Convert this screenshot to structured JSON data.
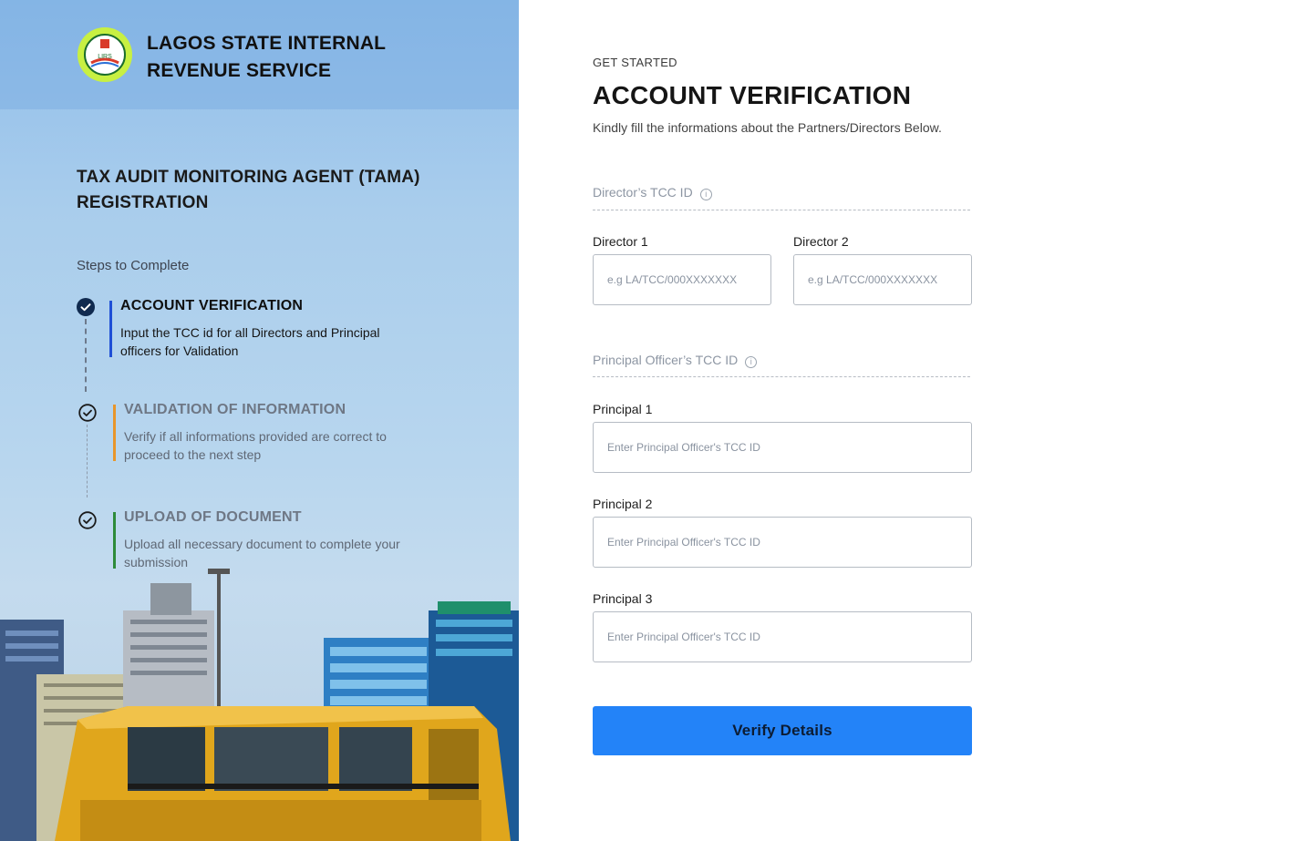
{
  "brand": {
    "org_name": "LAGOS STATE INTERNAL REVENUE SERVICE",
    "logo_text": "LIRS"
  },
  "sidebar": {
    "heading": "TAX AUDIT MONITORING AGENT (TAMA) REGISTRATION",
    "steps_label": "Steps to Complete",
    "steps": [
      {
        "title": "ACCOUNT VERIFICATION",
        "desc": "Input the TCC id for all Directors and Principal officers for Validation",
        "status": "active",
        "accent": "#1f4fd6"
      },
      {
        "title": "VALIDATION OF INFORMATION",
        "desc": "Verify if all informations provided are correct to proceed to the next step",
        "status": "pending",
        "accent": "#e8962b"
      },
      {
        "title": "UPLOAD OF DOCUMENT",
        "desc": "Upload all necessary document to complete your submission",
        "status": "pending",
        "accent": "#2e8b3a"
      }
    ]
  },
  "form": {
    "eyebrow": "GET STARTED",
    "title": "ACCOUNT VERIFICATION",
    "subtitle": "Kindly fill the informations about the Partners/Directors Below.",
    "directors_section": "Director’s TCC ID",
    "directors": [
      {
        "label": "Director 1",
        "placeholder": "e.g LA/TCC/000XXXXXXX",
        "value": ""
      },
      {
        "label": "Director 2",
        "placeholder": "e.g LA/TCC/000XXXXXXX",
        "value": ""
      }
    ],
    "principals_section": "Principal Officer’s TCC ID",
    "principals": [
      {
        "label": "Principal 1",
        "placeholder": "Enter Principal Officer's TCC ID",
        "value": ""
      },
      {
        "label": "Principal 2",
        "placeholder": "Enter Principal Officer's TCC ID",
        "value": ""
      },
      {
        "label": "Principal 3",
        "placeholder": "Enter Principal Officer's TCC ID",
        "value": ""
      }
    ],
    "submit_label": "Verify Details"
  },
  "colors": {
    "primary_button": "#2383f8",
    "active_step": "#1f4fd6",
    "validation_step": "#e8962b",
    "upload_step": "#2e8b3a"
  }
}
